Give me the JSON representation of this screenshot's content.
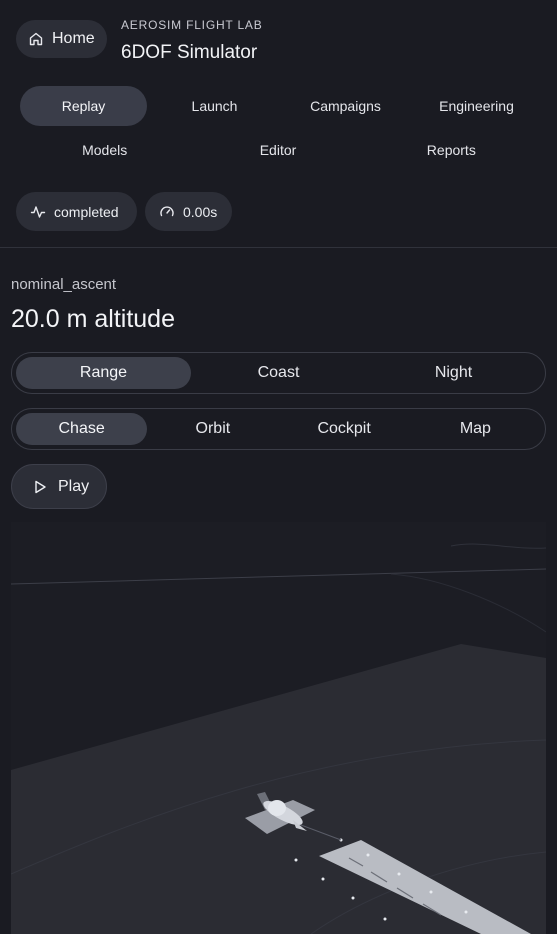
{
  "header": {
    "home_label": "Home",
    "brand_sub": "AEROSIM FLIGHT LAB",
    "brand_title": "6DOF Simulator"
  },
  "nav": {
    "row1": [
      "Replay",
      "Launch",
      "Campaigns",
      "Engineering"
    ],
    "row2": [
      "Models",
      "Editor",
      "Reports"
    ],
    "active": "Replay"
  },
  "status": {
    "state": "completed",
    "time": "0.00s"
  },
  "run": {
    "name": "nominal_ascent",
    "metric": "20.0 m altitude"
  },
  "environment": {
    "options": [
      "Range",
      "Coast",
      "Night"
    ],
    "selected": "Range"
  },
  "camera": {
    "options": [
      "Chase",
      "Orbit",
      "Cockpit",
      "Map"
    ],
    "selected": "Chase"
  },
  "playback": {
    "play_label": "Play"
  },
  "icons": {
    "home": "home-icon",
    "status": "activity-icon",
    "time": "gauge-icon",
    "play": "play-icon"
  },
  "colors": {
    "background": "#1a1b22",
    "surface": "#2c2e37",
    "active": "#3a3d49",
    "terrain": "#2b2c33",
    "runway": "#b9bcc3"
  }
}
